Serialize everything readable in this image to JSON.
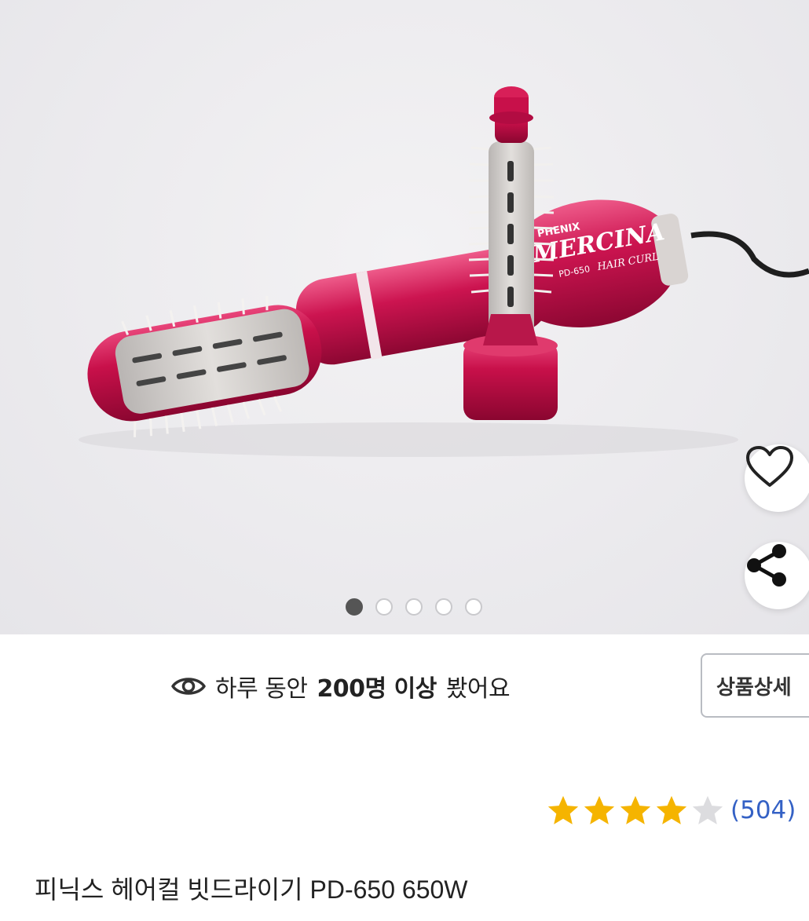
{
  "gallery": {
    "product_logo_brand": "PHENIX",
    "product_logo_name": "MERCINA",
    "product_logo_model": "PD-650",
    "product_logo_line": "HAIR CURL",
    "page_count": 5,
    "current_page": 1
  },
  "actions": {
    "like_icon": "heart-icon",
    "share_icon": "share-icon"
  },
  "views": {
    "icon": "eye-icon",
    "prefix": "하루 동안",
    "highlight": "200명 이상",
    "suffix": "봤어요"
  },
  "detail_button_label": "상품상세",
  "rating": {
    "stars": 4,
    "max_stars": 5,
    "count_text": "(504)",
    "star_color": "#f5b400",
    "empty_star_color": "#dcdcdf"
  },
  "product": {
    "title": "피닉스 헤어컬 빗드라이기 PD-650 650W"
  },
  "colors": {
    "accent_link": "#3461c5",
    "product_pink": "#c8104a"
  }
}
